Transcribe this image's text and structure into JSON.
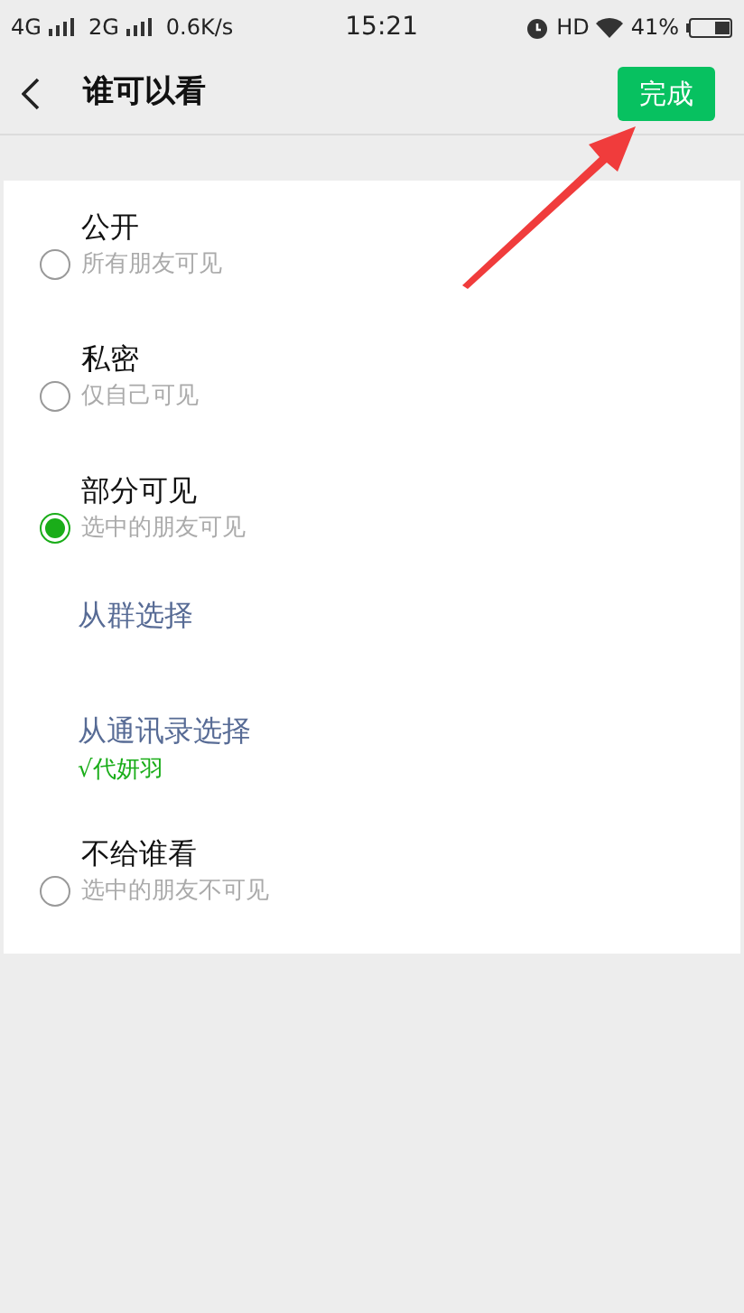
{
  "status_bar": {
    "network_1": "4G",
    "network_2": "2G",
    "speed": "0.6K/s",
    "time": "15:21",
    "hd": "HD",
    "battery": "41%"
  },
  "header": {
    "title": "谁可以看",
    "done_button": "完成"
  },
  "options": [
    {
      "kind": "radio",
      "label": "公开",
      "description": "所有朋友可见",
      "selected": false
    },
    {
      "kind": "radio",
      "label": "私密",
      "description": "仅自己可见",
      "selected": false
    },
    {
      "kind": "radio",
      "label": "部分可见",
      "description": "选中的朋友可见",
      "selected": true
    },
    {
      "kind": "link",
      "label": "从群选择"
    },
    {
      "kind": "link",
      "label": "从通讯录选择",
      "picked": "√代妍羽"
    },
    {
      "kind": "radio",
      "label": "不给谁看",
      "description": "选中的朋友不可见",
      "selected": false
    }
  ]
}
